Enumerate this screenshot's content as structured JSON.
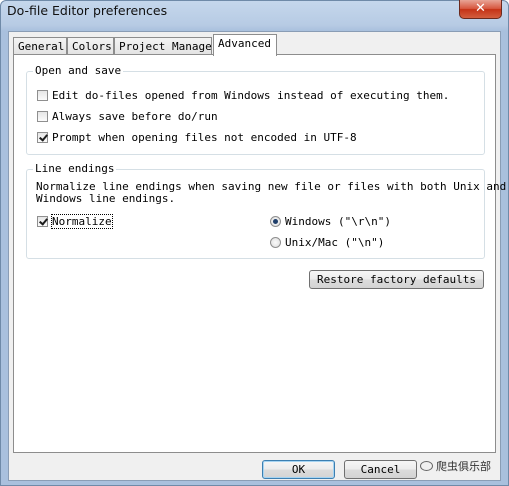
{
  "window": {
    "title": "Do-file Editor preferences",
    "close_glyph": "✕"
  },
  "tabs": [
    {
      "label": "General",
      "active": false
    },
    {
      "label": "Colors",
      "active": false
    },
    {
      "label": "Project Manager",
      "active": false
    },
    {
      "label": "Advanced",
      "active": true
    }
  ],
  "open_and_save": {
    "title": "Open and save",
    "options": [
      {
        "label": "Edit do-files opened from Windows instead of executing them.",
        "checked": false
      },
      {
        "label": "Always save before do/run",
        "checked": false
      },
      {
        "label": "Prompt when opening files not encoded in UTF-8",
        "checked": true
      }
    ]
  },
  "line_endings": {
    "title": "Line endings",
    "description_line1": "Normalize line endings when saving new file or files with both Unix and",
    "description_line2": "Windows line endings.",
    "normalize": {
      "label": "Normalize",
      "checked": true
    },
    "options": [
      {
        "label": "Windows (\"\\r\\n\")",
        "selected": true
      },
      {
        "label": "Unix/Mac (\"\\n\")",
        "selected": false
      }
    ]
  },
  "buttons": {
    "restore": "Restore factory defaults",
    "ok": "OK",
    "cancel": "Cancel"
  },
  "watermark": {
    "text": "爬虫俱乐部"
  },
  "colors": {
    "titlebar": "#b7cbe4",
    "close": "#c43216",
    "default_button_border": "#3c7fb1"
  }
}
